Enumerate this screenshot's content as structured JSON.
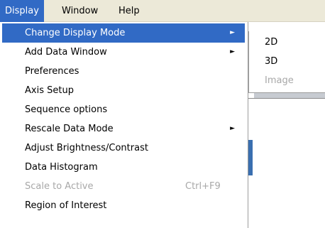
{
  "menubar": {
    "items": [
      {
        "label": "Display"
      },
      {
        "label": "Window"
      },
      {
        "label": "Help"
      }
    ]
  },
  "display_menu": {
    "items": [
      {
        "label": "Change Display Mode",
        "has_submenu": true,
        "highlighted": true
      },
      {
        "label": "Add Data Window",
        "has_submenu": true
      },
      {
        "label": "Preferences"
      },
      {
        "label": "Axis Setup"
      },
      {
        "label": "Sequence options"
      },
      {
        "label": "Rescale Data Mode",
        "has_submenu": true
      },
      {
        "label": "Adjust Brightness/Contrast"
      },
      {
        "label": "Data Histogram"
      },
      {
        "label": "Scale to Active",
        "shortcut": "Ctrl+F9",
        "disabled": true
      },
      {
        "label": "Region of Interest"
      }
    ],
    "arrow_glyph": "►"
  },
  "submenu": {
    "items": [
      {
        "label": "2D"
      },
      {
        "label": "3D"
      },
      {
        "label": "Image",
        "disabled": true
      }
    ]
  },
  "colors": {
    "highlight": "#316ac5",
    "menubar_bg": "#ece9d8",
    "disabled_text": "#a8a8a8"
  }
}
